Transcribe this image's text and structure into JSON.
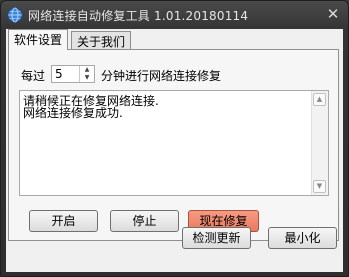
{
  "window": {
    "title": "网络连接自动修复工具 1.01.20180114",
    "close_symbol": "✕"
  },
  "tabs": [
    {
      "label": "软件设置",
      "active": true
    },
    {
      "label": "关于我们",
      "active": false
    }
  ],
  "settings": {
    "prefix": "每过",
    "interval_value": "5",
    "suffix": "分钟进行网络连接修复"
  },
  "log": {
    "lines": [
      "请稍候正在修复网络连接.",
      "网络连接修复成功."
    ]
  },
  "buttons": {
    "start": "开启",
    "stop": "停止",
    "repair_now": "现在修复",
    "check_update": "检测更新",
    "minimize": "最小化"
  },
  "colors": {
    "accent_button": "#ea7a5e",
    "title_bar": "#3a3a3a"
  }
}
